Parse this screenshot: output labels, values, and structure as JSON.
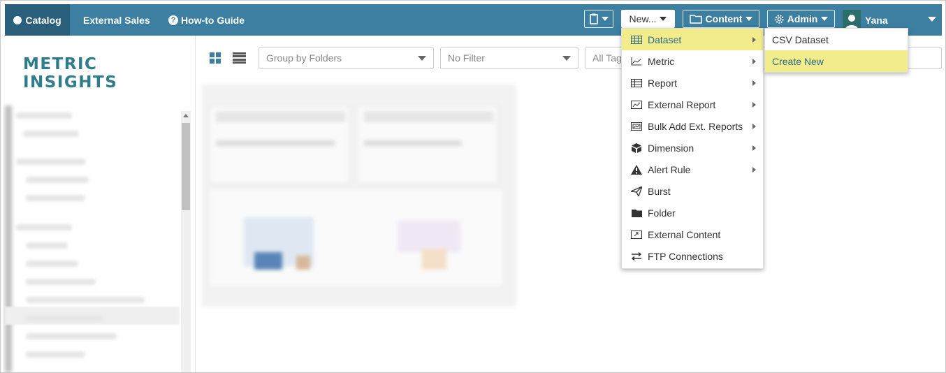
{
  "nav": {
    "catalog": "Catalog",
    "external_sales": "External Sales",
    "howto": "How-to Guide"
  },
  "toolbar_right": {
    "new_label": "New...",
    "content_label": "Content",
    "admin_label": "Admin",
    "user_name": "Yana"
  },
  "logo_text": "METRIC INSIGHTS",
  "filters": {
    "group_by": "Group by Folders",
    "filter": "No Filter",
    "tags": "All Tags"
  },
  "new_menu": {
    "items": [
      {
        "label": "Dataset",
        "icon": "table-icon",
        "submenu": true,
        "highlighted": true
      },
      {
        "label": "Metric",
        "icon": "line-chart-icon",
        "submenu": true
      },
      {
        "label": "Report",
        "icon": "report-icon",
        "submenu": true
      },
      {
        "label": "External Report",
        "icon": "external-report-icon",
        "submenu": true
      },
      {
        "label": "Bulk Add Ext. Reports",
        "icon": "bulk-report-icon",
        "submenu": true
      },
      {
        "label": "Dimension",
        "icon": "cube-icon",
        "submenu": true
      },
      {
        "label": "Alert Rule",
        "icon": "warning-icon",
        "submenu": true
      },
      {
        "label": "Burst",
        "icon": "paper-plane-icon",
        "submenu": false
      },
      {
        "label": "Folder",
        "icon": "folder-icon",
        "submenu": false
      },
      {
        "label": "External Content",
        "icon": "external-content-icon",
        "submenu": false
      },
      {
        "label": "FTP Connections",
        "icon": "transfer-icon",
        "submenu": false
      }
    ]
  },
  "dataset_submenu": {
    "items": [
      {
        "label": "CSV Dataset",
        "highlighted": false
      },
      {
        "label": "Create New",
        "highlighted": true
      }
    ]
  },
  "colors": {
    "topbar": "#3c7fa0",
    "active_tab": "#2a5f7c",
    "highlight": "#f3ec8a",
    "highlight_text": "#2c6c88",
    "logo": "#2f7d8a"
  }
}
